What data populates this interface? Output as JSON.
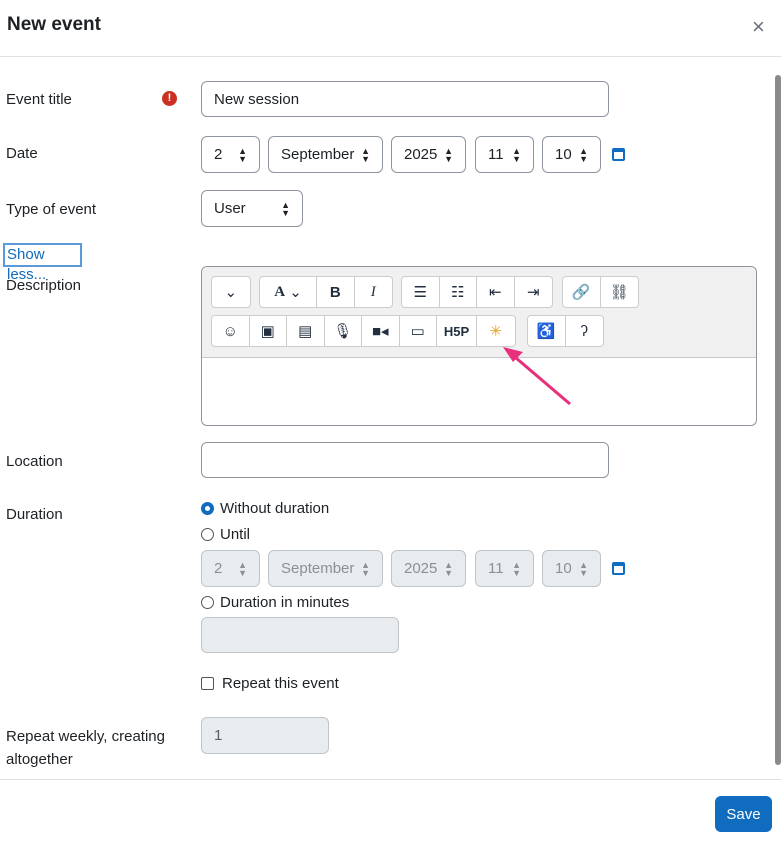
{
  "dialog": {
    "title": "New event",
    "close_icon": "close-icon"
  },
  "form": {
    "event_title": {
      "label": "Event title",
      "value": "New session",
      "required_icon": "exclamation-circle-icon"
    },
    "date": {
      "label": "Date",
      "day": "2",
      "month": "September",
      "year": "2025",
      "hour": "11",
      "minute": "10"
    },
    "type": {
      "label": "Type of event",
      "value": "User"
    },
    "show_less": "Show less...",
    "description": {
      "label": "Description",
      "toolbar_row1": [
        "chevron-down-icon",
        "font-color-icon",
        "bold-icon",
        "italic-icon",
        "bullet-list-icon",
        "numbered-list-icon",
        "outdent-icon",
        "indent-icon",
        "link-icon",
        "unlink-icon"
      ],
      "toolbar_row2": [
        "emoji-icon",
        "image-icon",
        "media-file-icon",
        "microphone-icon",
        "video-icon",
        "responsive-icon",
        "h5p-icon",
        "ai-sparkle-icon",
        "accessibility-checker-icon",
        "screen-reader-icon"
      ],
      "h5p_label": "H5P"
    },
    "location": {
      "label": "Location",
      "value": ""
    },
    "duration": {
      "label": "Duration",
      "without": "Without duration",
      "until": "Until",
      "minutes": "Duration in minutes",
      "selected": "without",
      "until_date": {
        "day": "2",
        "month": "September",
        "year": "2025",
        "hour": "11",
        "minute": "10"
      },
      "minutes_value": ""
    },
    "repeat": {
      "label": "Repeat this event",
      "checked": false
    },
    "repeat_weekly": {
      "label_line1": "Repeat weekly, creating",
      "label_line2": "altogether",
      "value": "1"
    }
  },
  "footer": {
    "save": "Save"
  },
  "colors": {
    "accent": "#0f6cbf",
    "error": "#ca3120",
    "annotation_arrow": "#e8307a"
  }
}
